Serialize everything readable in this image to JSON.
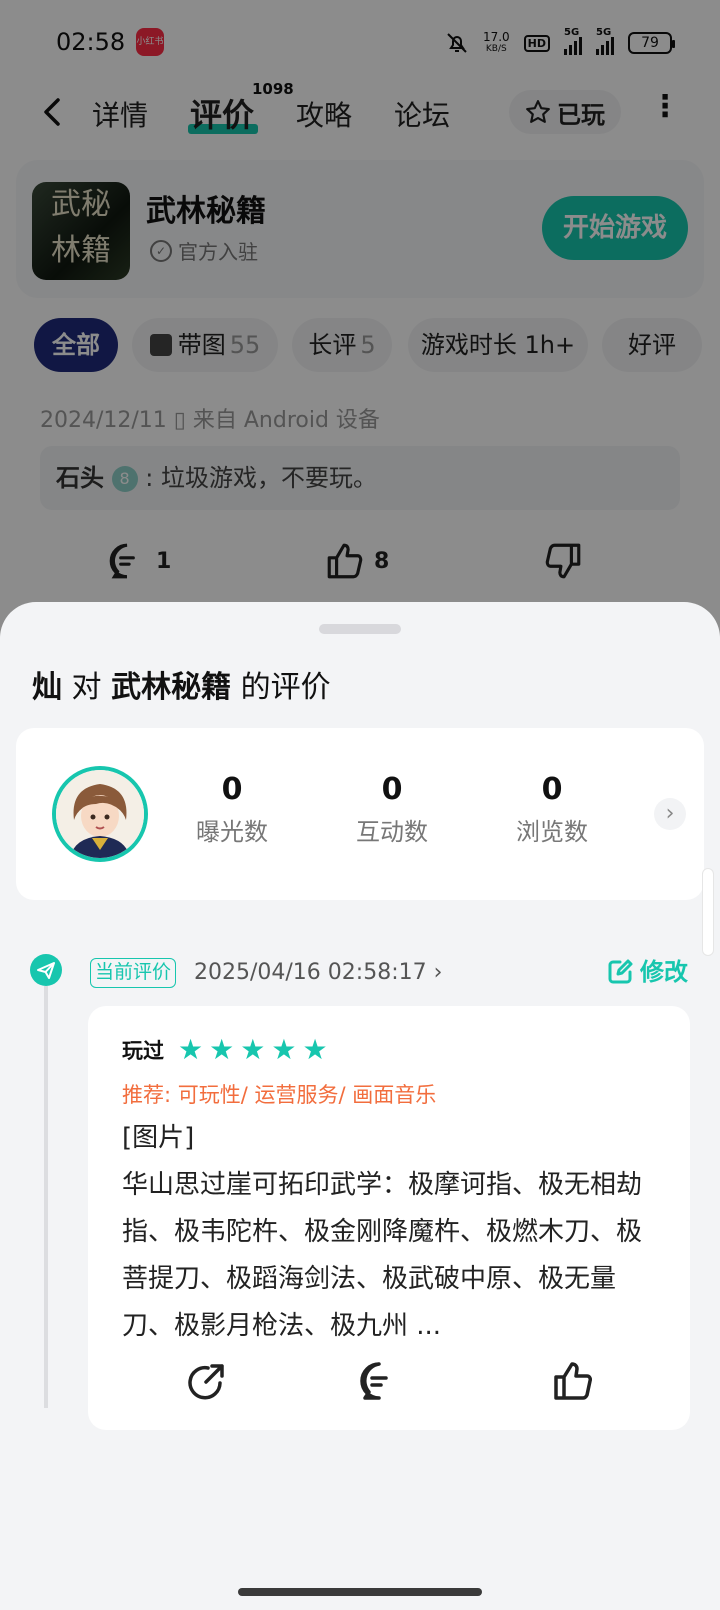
{
  "status_bar": {
    "time": "02:58",
    "app_badge": "小红书",
    "speed_value": "17.0",
    "speed_unit": "KB/S",
    "hd_label": "HD",
    "signal1_label": "5G",
    "signal2_label": "5G",
    "battery": "79"
  },
  "nav": {
    "tabs": [
      "详情",
      "评价",
      "攻略",
      "论坛"
    ],
    "active_tab": "评价",
    "review_count": "1098",
    "played_label": "已玩"
  },
  "game": {
    "cover_text": "武秘 林籍",
    "title": "武林秘籍",
    "official": "官方入驻",
    "start_button": "开始游戏"
  },
  "filters": [
    {
      "label": "全部",
      "count": ""
    },
    {
      "label": "带图",
      "count": "55"
    },
    {
      "label": "长评",
      "count": "5"
    },
    {
      "label": "游戏时长 1h+",
      "count": ""
    },
    {
      "label": "好评",
      "count": ""
    }
  ],
  "bg_review": {
    "meta": "2024/12/11  ▯ 来自 Android 设备",
    "quote_user": "石头",
    "quote_level": "8",
    "quote_text": ": 垃圾游戏，不要玩。",
    "comments": "1",
    "likes": "8"
  },
  "sheet": {
    "user": "灿",
    "mid": " 对 ",
    "game": "武林秘籍",
    "suffix": " 的评价",
    "stats": [
      {
        "value": "0",
        "label": "曝光数"
      },
      {
        "value": "0",
        "label": "互动数"
      },
      {
        "value": "0",
        "label": "浏览数"
      }
    ],
    "current_badge": "当前评价",
    "date": "2025/04/16 02:58:17",
    "edit_label": "修改",
    "review": {
      "played": "玩过",
      "stars": 5,
      "recommend": "推荐: 可玩性/ 运营服务/ 画面音乐",
      "image_tag": "[图片]",
      "body": "华山思过崖可拓印武学：极摩诃指、极无相劫指、极韦陀杵、极金刚降魔杵、极燃木刀、极菩提刀、极蹈海剑法、极武破中原、极无量刀、极影月枪法、极九州 ..."
    }
  },
  "colors": {
    "accent": "#17c6ae",
    "active_chip": "#1f2a7c",
    "recommend": "#f26d3d"
  }
}
